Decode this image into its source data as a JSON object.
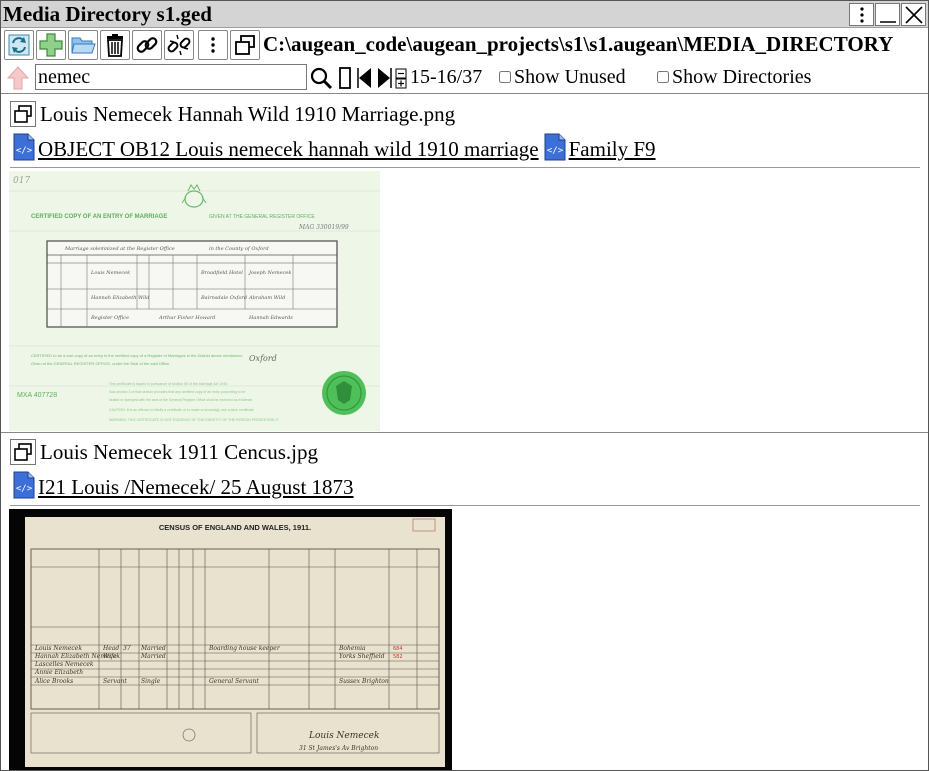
{
  "window": {
    "title": "Media Directory s1.ged"
  },
  "toolbar": {
    "path": "C:\\augean_code\\augean_projects\\s1\\s1.augean\\MEDIA_DIRECTORY",
    "buttons": [
      "refresh-icon",
      "add-icon",
      "open-folder-icon",
      "delete-icon",
      "link-icon",
      "unlink-icon",
      "menu-icon",
      "new-window-icon"
    ]
  },
  "search": {
    "value": "nemec",
    "pager": "15-16/37",
    "show_unused_label": "Show Unused",
    "show_directories_label": "Show Directories"
  },
  "entries": [
    {
      "filename": "Louis Nemecek Hannah Wild 1910 Marriage.png",
      "links": [
        "OBJECT OB12 Louis nemecek hannah wild 1910 marriage",
        "Family F9"
      ],
      "image": {
        "kind": "marriage-certificate",
        "doc_title": "CERTIFIED COPY OF AN ENTRY OF MARRIAGE",
        "doc_subtitle": "GIVEN AT THE GENERAL REGISTER OFFICE",
        "serial": "MXA 407728",
        "corner_mark": "017"
      }
    },
    {
      "filename": "Louis Nemecek 1911 Cencus.jpg",
      "links": [
        "I21 Louis /Nemecek/ 25 August 1873"
      ],
      "image": {
        "kind": "census-form",
        "doc_title": "CENSUS OF ENGLAND AND WALES, 1911."
      }
    }
  ],
  "colors": {
    "titlebar": "#d4d4d4",
    "certificate_bg": "#eef6e8",
    "certificate_ink": "#7cc47a",
    "census_bg": "#e9e2cf",
    "link_icon_blue": "#3d6fd8"
  }
}
